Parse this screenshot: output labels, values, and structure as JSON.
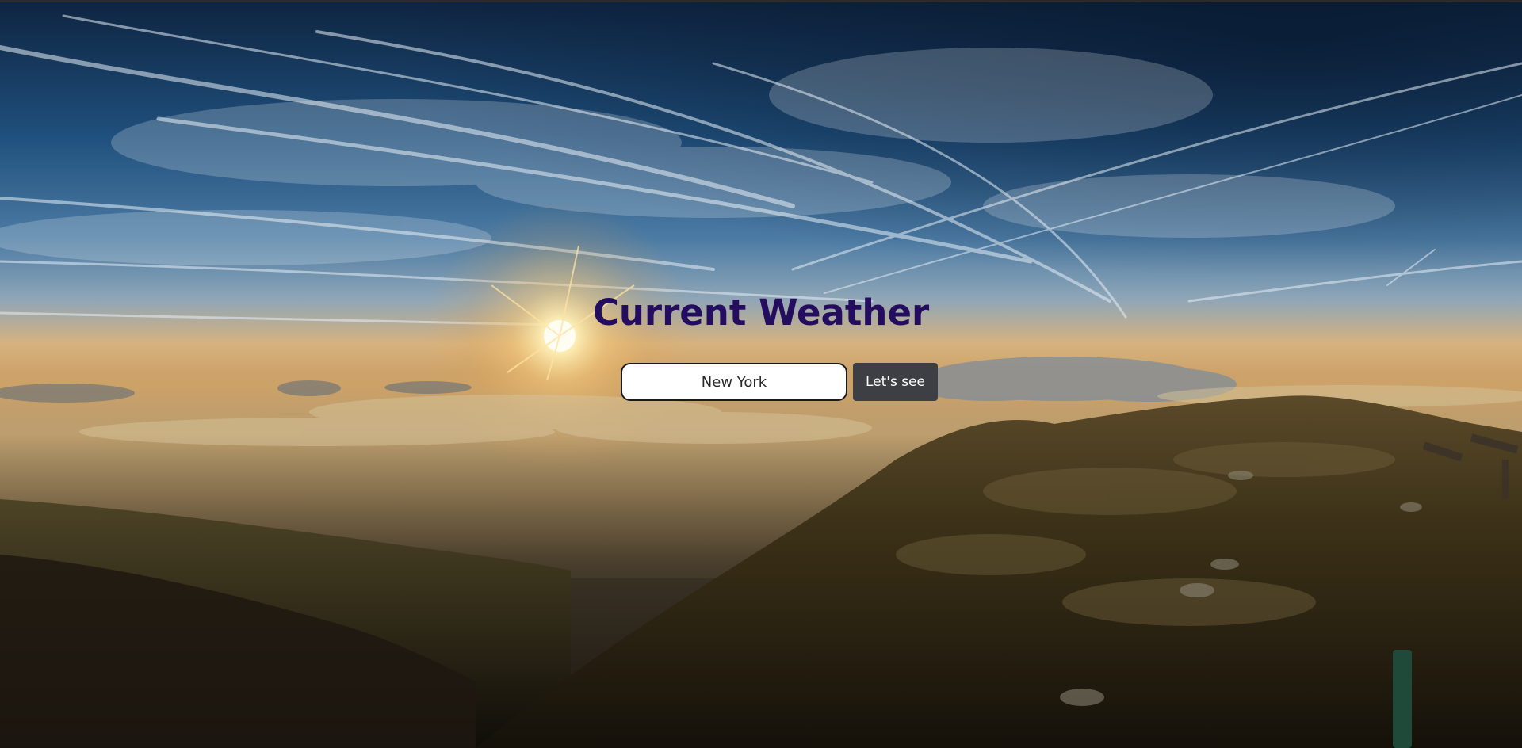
{
  "app": {
    "title": "Current Weather"
  },
  "search": {
    "value": "New York",
    "button_label": "Let's see"
  },
  "colors": {
    "title": "#240d5e",
    "button_bg": "#3d3f45",
    "button_text": "#ffffff",
    "input_bg": "#ffffff",
    "input_border": "#1a1a1a"
  },
  "background": {
    "scene": "sunrise-over-clouds-mountain-ridge"
  }
}
